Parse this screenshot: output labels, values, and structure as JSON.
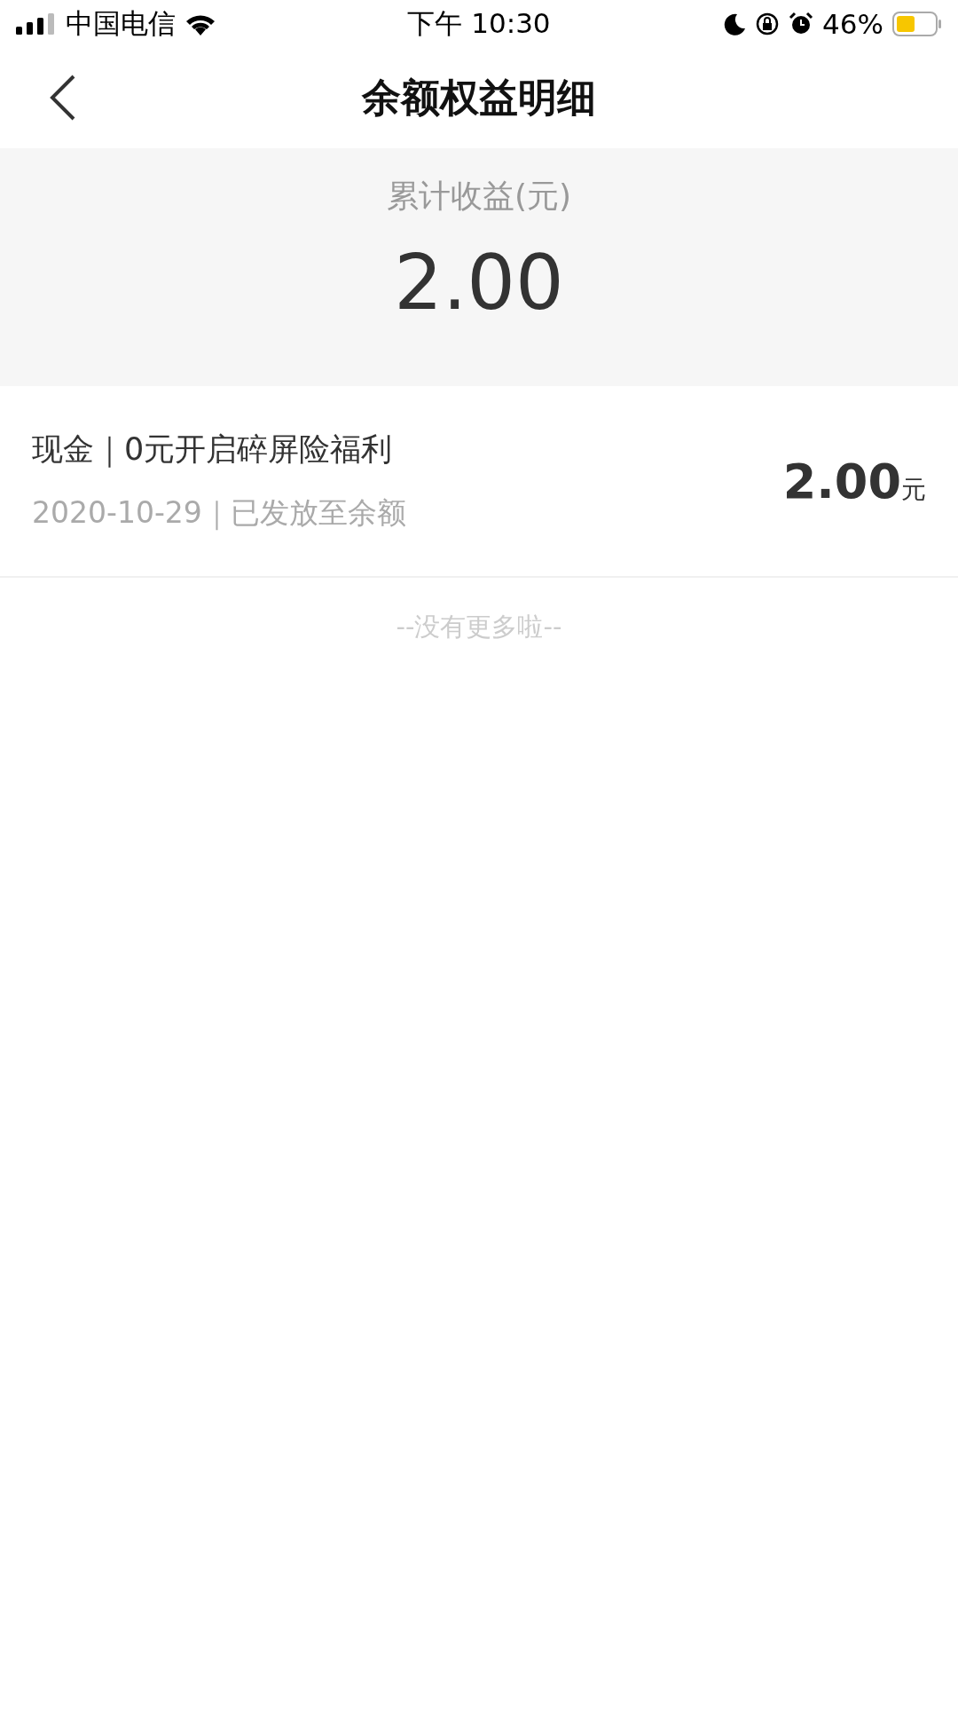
{
  "status_bar": {
    "carrier": "中国电信",
    "time": "下午 10:30",
    "battery": "46%"
  },
  "nav": {
    "title": "余额权益明细"
  },
  "summary": {
    "label": "累计收益(元)",
    "amount": "2.00"
  },
  "records": [
    {
      "title": "现金｜0元开启碎屏险福利",
      "subtitle": "2020-10-29｜已发放至余额",
      "amount": "2.00",
      "unit": "元"
    }
  ],
  "footer": "--没有更多啦--"
}
